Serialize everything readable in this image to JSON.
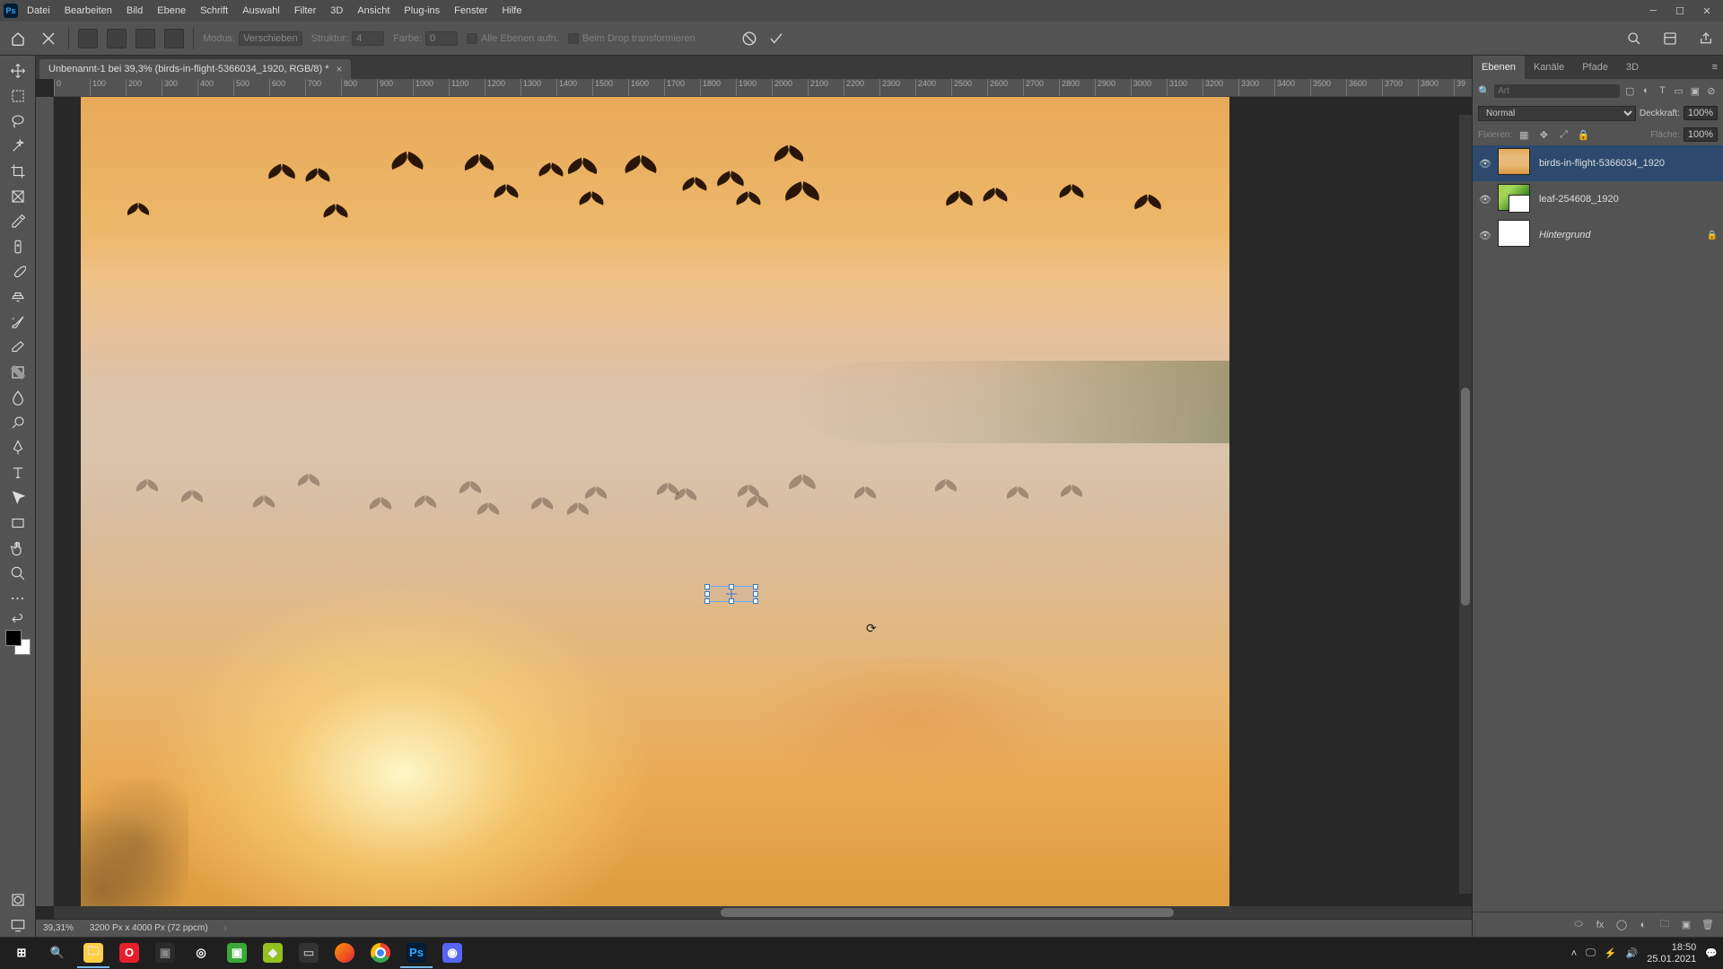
{
  "menu": [
    "Datei",
    "Bearbeiten",
    "Bild",
    "Ebene",
    "Schrift",
    "Auswahl",
    "Filter",
    "3D",
    "Ansicht",
    "Plug-ins",
    "Fenster",
    "Hilfe"
  ],
  "options_bar": {
    "modus_label": "Modus:",
    "modus_value": "Verschieben",
    "struktur_label": "Struktur:",
    "struktur_value": "4",
    "farbe_label": "Farbe:",
    "farbe_value": "0",
    "checkbox1": "Alle Ebenen aufn.",
    "checkbox2": "Beim Drop transformieren"
  },
  "document": {
    "tab_title": "Unbenannt-1 bei 39,3% (birds-in-flight-5366034_1920, RGB/8) *"
  },
  "ruler_ticks": [
    "0",
    "100",
    "200",
    "300",
    "400",
    "500",
    "600",
    "700",
    "800",
    "900",
    "1000",
    "1100",
    "1200",
    "1300",
    "1400",
    "1500",
    "1600",
    "1700",
    "1800",
    "1900",
    "2000",
    "2100",
    "2200",
    "2300",
    "2400",
    "2500",
    "2600",
    "2700",
    "2800",
    "2900",
    "3000",
    "3100",
    "3200",
    "3300",
    "3400",
    "3500",
    "3600",
    "3700",
    "3800",
    "39"
  ],
  "status_bar": {
    "zoom": "39,31%",
    "info": "3200 Px x 4000 Px (72 ppcm)"
  },
  "panels": {
    "tabs": [
      "Ebenen",
      "Kanäle",
      "Pfade",
      "3D"
    ],
    "filter_placeholder": "Art",
    "blend_mode": "Normal",
    "opacity_label": "Deckkraft:",
    "opacity_value": "100%",
    "lock_label": "Fixieren:",
    "fill_label": "Fläche:",
    "fill_value": "100%",
    "layers": [
      {
        "name": "birds-in-flight-5366034_1920",
        "selected": true,
        "thumb": "birds"
      },
      {
        "name": "leaf-254608_1920",
        "selected": false,
        "thumb": "leaf"
      },
      {
        "name": "Hintergrund",
        "selected": false,
        "thumb": "white",
        "locked": true,
        "italic": true
      }
    ]
  },
  "taskbar": {
    "time": "18:50",
    "date": "25.01.2021"
  }
}
